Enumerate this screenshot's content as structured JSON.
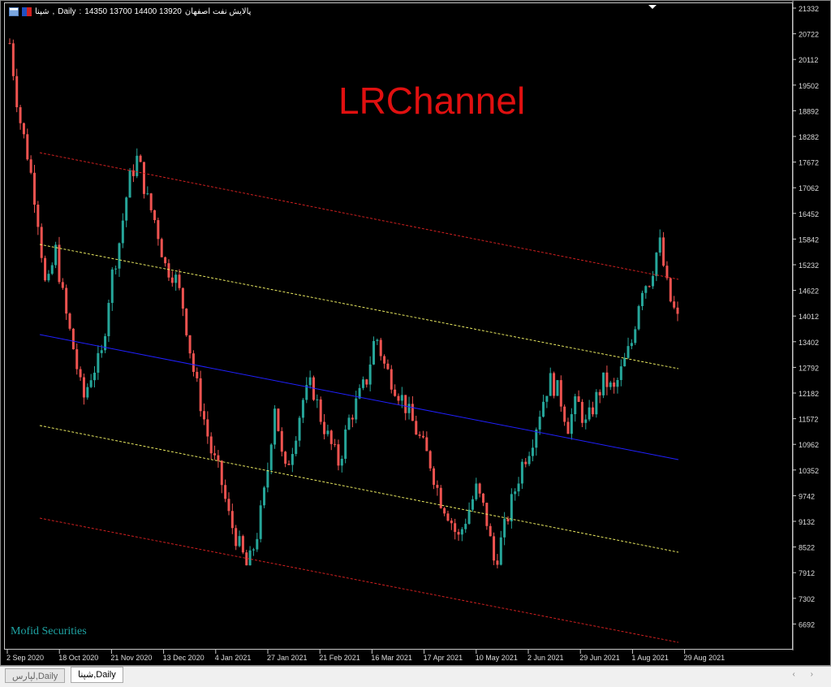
{
  "header": {
    "symbol": "شپنا",
    "timeframe": "Daily",
    "ohlc": "14350 13700 14400 13920",
    "company": "پالایش نفت اصفهان"
  },
  "indicator_label": "LRChannel",
  "watermark": "Mofid Securities",
  "tabs": [
    {
      "label": "لپارس,Daily",
      "active": false
    },
    {
      "label": "شپنا,Daily",
      "active": true
    }
  ],
  "colors": {
    "bull": "#26a69a",
    "bear": "#ef5350",
    "upper": "#d02020",
    "mid": "#2020ff",
    "inner": "#e8e860"
  },
  "chart_data": {
    "type": "candlestick",
    "price_ticks": [
      21332,
      20722,
      20112,
      19502,
      18892,
      18282,
      17672,
      17062,
      16452,
      15842,
      15232,
      14622,
      14012,
      13402,
      12792,
      12182,
      11572,
      10962,
      10352,
      9742,
      9132,
      8522,
      7912,
      7302,
      6692
    ],
    "ylim": [
      6400,
      21500
    ],
    "date_ticks": [
      "2 Sep 2020",
      "18 Oct 2020",
      "21 Nov 2020",
      "13 Dec 2020",
      "4 Jan 2021",
      "27 Jan 2021",
      "21 Feb 2021",
      "16 Mar 2021",
      "17 Apr 2021",
      "10 May 2021",
      "2 Jun 2021",
      "29 Jun 2021",
      "1 Aug 2021",
      "29 Aug 2021"
    ],
    "close_path": [
      20500,
      18800,
      17800,
      16500,
      14500,
      15600,
      14200,
      13200,
      12000,
      12700,
      13000,
      14800,
      15800,
      17200,
      17800,
      16800,
      16200,
      15200,
      15000,
      14200,
      12800,
      11800,
      10800,
      10200,
      9200,
      8600,
      8000,
      8800,
      10000,
      12000,
      10200,
      11000,
      12000,
      12400,
      11600,
      11000,
      10500,
      11500,
      12000,
      12500,
      13600,
      12800,
      12400,
      12000,
      11500,
      11000,
      10500,
      9700,
      9300,
      8700,
      9300,
      9900,
      9300,
      8100,
      8900,
      9700,
      10500,
      11000,
      11800,
      12500,
      12200,
      11400,
      12000,
      11400,
      12000,
      12500,
      12200,
      12800,
      13400,
      14700,
      14900,
      15800,
      14500,
      13920
    ],
    "channel": {
      "upper_outer": [
        17896,
        14885
      ],
      "upper_inner": [
        15715,
        12761
      ],
      "middle": [
        13572,
        10599
      ],
      "lower_inner": [
        11410,
        8398
      ],
      "lower_outer": [
        9209,
        6255
      ]
    }
  }
}
